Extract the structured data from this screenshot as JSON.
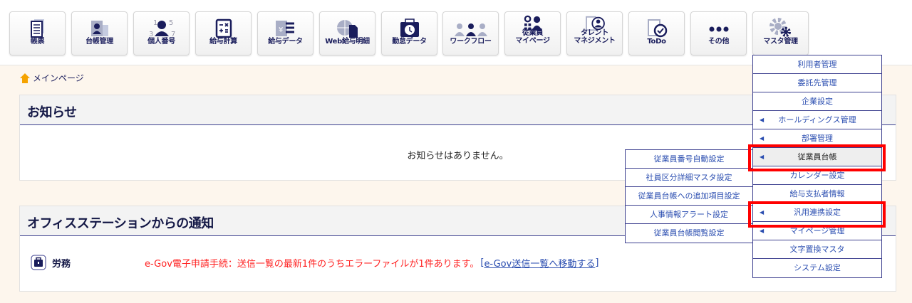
{
  "toolbar": [
    {
      "label": "帳票",
      "icon": "document-icon"
    },
    {
      "label": "台帳管理",
      "icon": "id-card-icon"
    },
    {
      "label": "個人番号",
      "icon": "person-number-icon"
    },
    {
      "label": "給与計算",
      "icon": "calculator-icon"
    },
    {
      "label": "給与データ",
      "icon": "payroll-data-icon"
    },
    {
      "label": "Web給与明細",
      "icon": "globe-document-icon"
    },
    {
      "label": "勤怠データ",
      "icon": "clock-icon"
    },
    {
      "label": "ワークフロー",
      "icon": "workflow-people-icon"
    },
    {
      "label": "従業員\nマイページ",
      "l1": "従業員",
      "l2": "マイページ",
      "icon": "employee-gear-icon"
    },
    {
      "label": "タレント\nマネジメント",
      "l1": "タレント",
      "l2": "マネジメント",
      "icon": "talent-clipboard-icon"
    },
    {
      "label": "ToDo",
      "icon": "todo-check-icon"
    },
    {
      "label": "その他",
      "icon": "more-dots-icon"
    },
    {
      "label": "マスタ管理",
      "icon": "gear-icon"
    }
  ],
  "breadcrumb": {
    "home": "メインページ"
  },
  "notice": {
    "title": "お知らせ",
    "empty": "お知らせはありません。"
  },
  "office": {
    "title": "オフィスステーションからの通知",
    "category": "労務",
    "message": "e-Gov電子申請手続：送信一覧の最新1件のうちエラーファイルが1件あります。",
    "link_open": "[",
    "link": "e-Gov送信一覧へ移動する",
    "link_close": "]"
  },
  "master_menu": [
    "利用者管理",
    "委託先管理",
    "企業設定",
    "ホールディングス管理",
    "部署管理",
    "従業員台帳",
    "カレンダー設定",
    "給与支払者情報",
    "汎用連携設定",
    "マイページ管理",
    "文字置換マスタ",
    "システム設定"
  ],
  "sub_menu": [
    "従業員番号自動設定",
    "社員区分詳細マスタ設定",
    "従業員台帳への追加項目設定",
    "人事情報アラート設定",
    "従業員台帳閲覧設定"
  ],
  "colors": {
    "navy": "#1a1d5c",
    "highlight": "#ff0000",
    "error": "#ff2222"
  }
}
